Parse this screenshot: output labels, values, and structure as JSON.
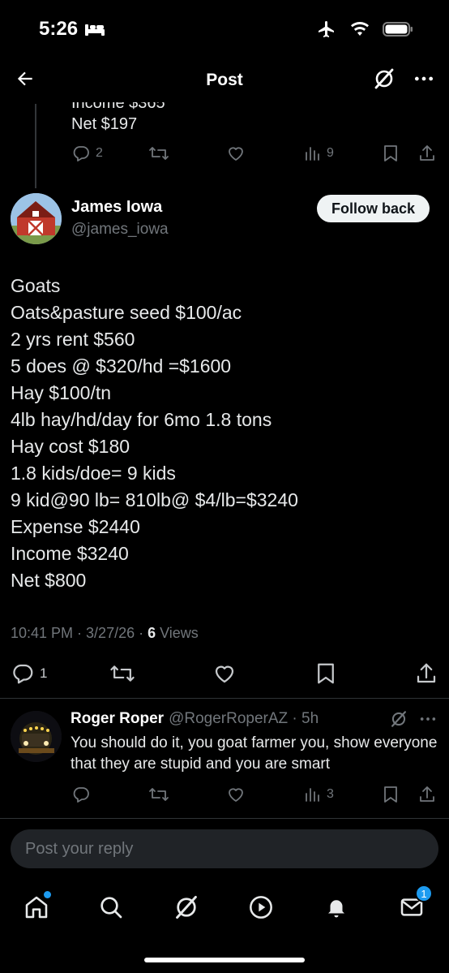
{
  "status": {
    "time": "5:26"
  },
  "topbar": {
    "title": "Post"
  },
  "prev_post": {
    "partial_line": "Income $365",
    "net_line": "Net $197",
    "replies": "2",
    "views": "9"
  },
  "post": {
    "author_name": "James Iowa",
    "author_handle": "@james_iowa",
    "follow_label": "Follow back",
    "lines": [
      "Goats",
      "Oats&pasture seed $100/ac",
      "2 yrs rent $560",
      "5 does @ $320/hd =$1600",
      "Hay $100/tn",
      "4lb hay/hd/day for 6mo 1.8 tons",
      "Hay cost $180",
      "1.8 kids/doe= 9 kids",
      "9 kid@90 lb= 810lb@ $4/lb=$3240",
      "Expense $2440",
      "Income $3240",
      "Net $800"
    ],
    "timestamp": "10:41 PM · 3/27/26 · ",
    "views_count": "6",
    "views_label": " Views",
    "replies": "1"
  },
  "reply": {
    "name": "Roger Roper",
    "handle_time": "@RogerRoperAZ · 5h",
    "text": "You should do it, you goat farmer you, show everyone that they are stupid and you are smart",
    "views": "3"
  },
  "composer": {
    "placeholder": "Post your reply"
  },
  "tabbar": {
    "messages_badge": "1"
  },
  "colors": {
    "accent": "#1d9bf0",
    "muted": "#71767b",
    "background": "#000000"
  }
}
